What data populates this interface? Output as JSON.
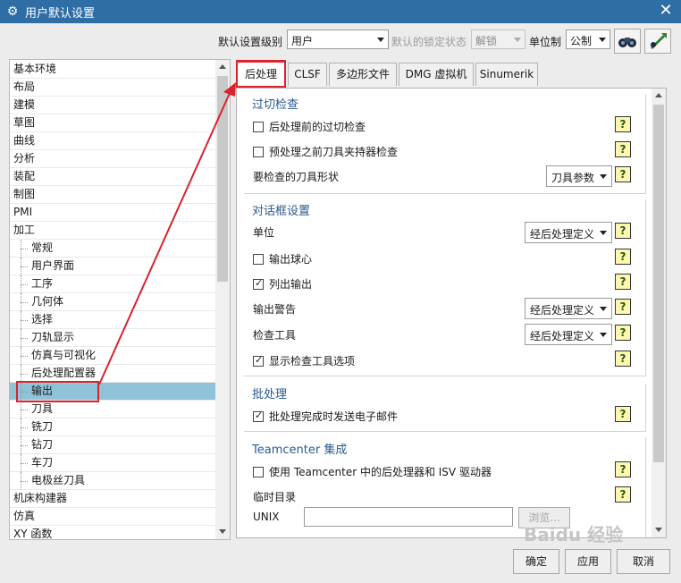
{
  "window": {
    "title": "用户默认设置",
    "close_glyph": "✕",
    "app_icon": "gear-icon"
  },
  "toolbar": {
    "level_label": "默认设置级别",
    "level_value": "用户",
    "lock_label": "默认的锁定状态",
    "lock_value": "解锁",
    "unit_label": "单位制",
    "unit_value": "公制",
    "icon1": "binoculars-icon",
    "icon2": "arrow-pick-icon"
  },
  "tree": {
    "items": [
      {
        "label": "基本环境",
        "level": 0
      },
      {
        "label": "布局",
        "level": 0
      },
      {
        "label": "建模",
        "level": 0
      },
      {
        "label": "草图",
        "level": 0
      },
      {
        "label": "曲线",
        "level": 0
      },
      {
        "label": "分析",
        "level": 0
      },
      {
        "label": "装配",
        "level": 0
      },
      {
        "label": "制图",
        "level": 0
      },
      {
        "label": "PMI",
        "level": 0
      },
      {
        "label": "加工",
        "level": 0
      },
      {
        "label": "常规",
        "level": 1
      },
      {
        "label": "用户界面",
        "level": 1
      },
      {
        "label": "工序",
        "level": 1
      },
      {
        "label": "几何体",
        "level": 1
      },
      {
        "label": "选择",
        "level": 1
      },
      {
        "label": "刀轨显示",
        "level": 1
      },
      {
        "label": "仿真与可视化",
        "level": 1
      },
      {
        "label": "后处理配置器",
        "level": 1
      },
      {
        "label": "输出",
        "level": 1,
        "selected": true
      },
      {
        "label": "刀具",
        "level": 1
      },
      {
        "label": "铣刀",
        "level": 1
      },
      {
        "label": "钻刀",
        "level": 1
      },
      {
        "label": "车刀",
        "level": 1
      },
      {
        "label": "电极丝刀具",
        "level": 1
      },
      {
        "label": "机床构建器",
        "level": 0
      },
      {
        "label": "仿真",
        "level": 0
      },
      {
        "label": "XY 函数",
        "level": 0
      }
    ]
  },
  "tabs": [
    "后处理",
    "CLSF",
    "多边形文件",
    "DMG 虚拟机",
    "Sinumerik"
  ],
  "groups": {
    "overcut": {
      "title": "过切检查",
      "pre_check": "后处理前的过切检查",
      "holder_check": "预处理之前刀具夹持器检查",
      "shape_label": "要检查的刀具形状",
      "shape_value": "刀具参数"
    },
    "dialog": {
      "title": "对话框设置",
      "unit_label": "单位",
      "unit_value": "经后处理定义",
      "ball_center": "输出球心",
      "list_output": "列出输出",
      "warning_label": "输出警告",
      "warning_value": "经后处理定义",
      "inspect_label": "检查工具",
      "inspect_value": "经后处理定义",
      "show_inspect": "显示检查工具选项"
    },
    "batch": {
      "title": "批处理",
      "email": "批处理完成时发送电子邮件"
    },
    "teamcenter": {
      "title": "Teamcenter 集成",
      "use_tc": "使用 Teamcenter 中的后处理器和 ISV 驱动器",
      "temp_dir": "临时目录",
      "unix_label": "UNIX",
      "browse": "浏览..."
    }
  },
  "help_glyph": "?",
  "footer": {
    "ok": "确定",
    "apply": "应用",
    "cancel": "取消"
  },
  "watermark": "Baidu 经验",
  "colors": {
    "titlebar": "#2e6ea5",
    "selection": "#8fc3d9",
    "callout": "#d9232d"
  }
}
